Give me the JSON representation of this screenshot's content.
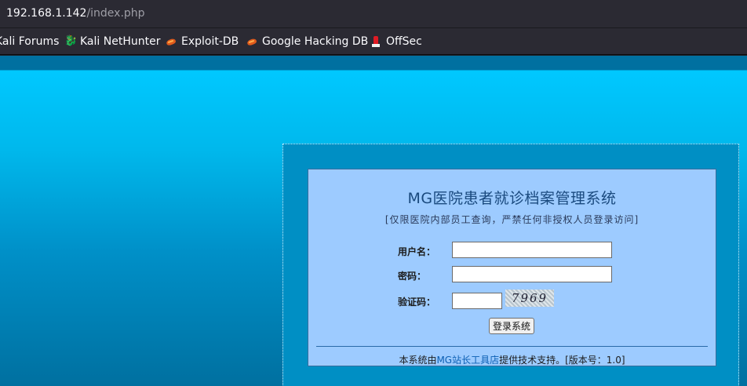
{
  "browser": {
    "url_host": "192.168.1.142",
    "url_path": "/index.php",
    "bookmarks": [
      {
        "label": "Kali Forums",
        "icon": "kali-forums-icon"
      },
      {
        "label": "Kali NetHunter",
        "icon": "kali-dragon-icon"
      },
      {
        "label": "Exploit-DB",
        "icon": "exploit-db-bug-icon"
      },
      {
        "label": "Google Hacking DB",
        "icon": "ghdb-bug-icon"
      },
      {
        "label": "OffSec",
        "icon": "offsec-icon"
      }
    ]
  },
  "login": {
    "title": "MG医院患者就诊档案管理系统",
    "notice": "[仅限医院内部员工查询，严禁任何非授权人员登录访问]",
    "username_label": "用户名：",
    "username_value": "",
    "password_label": "密码：",
    "password_value": "",
    "captcha_label": "验证码：",
    "captcha_value": "",
    "captcha_text": "7969",
    "submit_label": "登录系统",
    "footer_prefix": "本系统由",
    "footer_link": "MG站长工具店",
    "footer_suffix": "提供技术支持。[版本号：1.0]"
  },
  "colors": {
    "page_gradient_top": "#00c8ff",
    "page_gradient_bottom": "#0070a0",
    "panel_bg": "#9dcbff",
    "title_color": "#1a4a7e",
    "link_color": "#0b5fb3"
  }
}
